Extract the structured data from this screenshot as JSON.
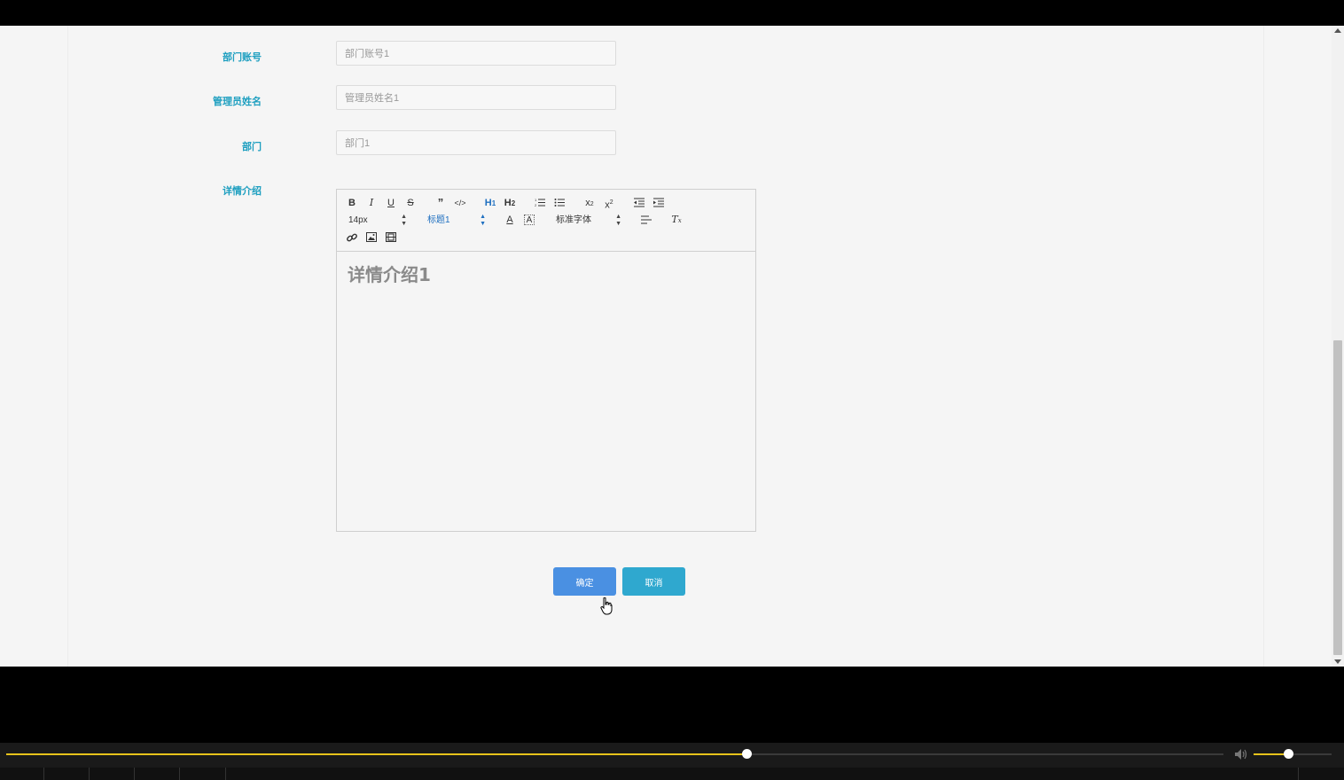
{
  "form": {
    "fields": [
      {
        "label": "部门账号",
        "value": "部门账号1"
      },
      {
        "label": "管理员姓名",
        "value": "管理员姓名1"
      },
      {
        "label": "部门",
        "value": "部门1"
      }
    ],
    "details_label": "详情介绍",
    "editor": {
      "font_size": "14px",
      "heading": "标题1",
      "font_family": "标准字体",
      "content": "详情介绍1"
    },
    "confirm_label": "确定",
    "cancel_label": "取消"
  },
  "player": {
    "progress": 0.608,
    "volume": 0.44,
    "progress_color": "#e6c21b"
  },
  "colors": {
    "label": "#1e9fc0",
    "confirm": "#4a90e2",
    "cancel": "#2fa8cf"
  },
  "icons": [
    "bold-icon",
    "italic-icon",
    "underline-icon",
    "strike-icon",
    "blockquote-icon",
    "code-icon",
    "h1-icon",
    "h2-icon",
    "ordered-list-icon",
    "bullet-list-icon",
    "subscript-icon",
    "superscript-icon",
    "outdent-icon",
    "indent-icon",
    "font-color-icon",
    "background-color-icon",
    "align-icon",
    "clear-format-icon",
    "link-icon",
    "image-icon",
    "video-icon",
    "volume-icon"
  ]
}
